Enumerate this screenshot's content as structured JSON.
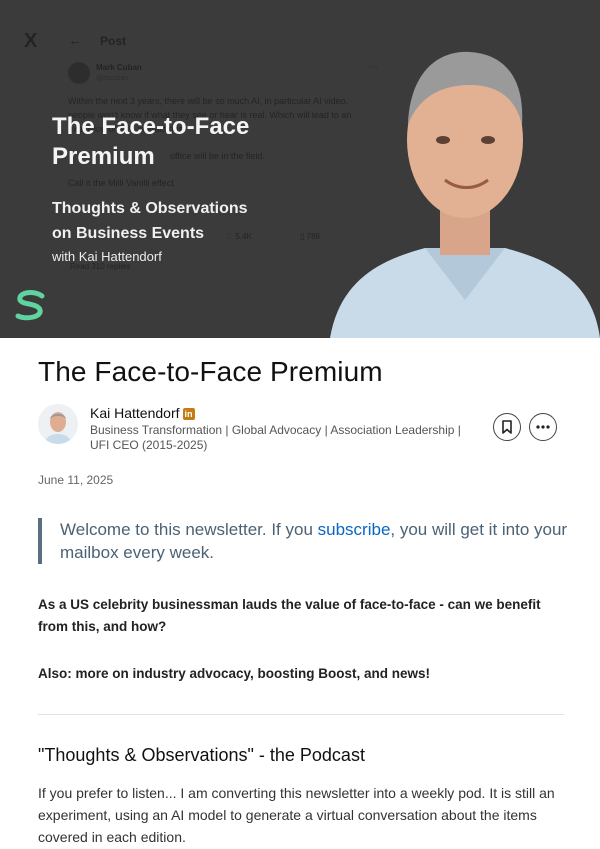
{
  "hero": {
    "tweet": {
      "x_logo": "X",
      "back_arrow": "←",
      "post_label": "Post",
      "author_name": "Mark Cuban",
      "author_handle": "@mcuban",
      "lines": [
        "Within the next 3 years, there will be so much AI, in particular AI video,",
        "people won't know if what they see or hear is real. Which will lead to an",
        "explosion of F2F interactions.",
        "office will be in the field.",
        "Call it the Milli Vanilli effect"
      ],
      "likes": "5.4K",
      "bookmarks": "786",
      "replies": "Read 310 replies"
    },
    "title": "The Face-to-Face Premium",
    "subtitle_line1": "Thoughts & Observations",
    "subtitle_line2": "on Business Events",
    "with_author": "with Kai Hattendorf"
  },
  "article": {
    "title": "The Face-to-Face Premium",
    "author": {
      "name": "Kai Hattendorf",
      "badge": "in",
      "headline": "Business Transformation | Global Advocacy | Association Leadership | UFI CEO (2015-2025)"
    },
    "date": "June 11, 2025",
    "welcome": {
      "before": "Welcome to this newsletter. If you ",
      "link": "subscribe",
      "after": ", you will get it into your mailbox every week."
    },
    "intro": "As a US celebrity businessman lauds the value of face-to-face - can we benefit from this, and how?",
    "also": "Also: more on industry advocacy, boosting Boost, and news!",
    "podcast_heading": "\"Thoughts & Observations\" - the Podcast",
    "podcast_text": "If you prefer to listen... I am converting this newsletter into a weekly pod. It is still an experiment, using an AI model to generate a virtual conversation about the items covered in each edition."
  },
  "icons": {
    "save": "bookmark-icon",
    "more": "more-icon",
    "brand": "brand-logo-icon"
  },
  "colors": {
    "hero_bg": "#3b3b3b",
    "link": "#0a66c2",
    "quote_text": "#4b6275",
    "brand_green": "#5fd3a0",
    "linkedin_badge": "#c37d16"
  }
}
